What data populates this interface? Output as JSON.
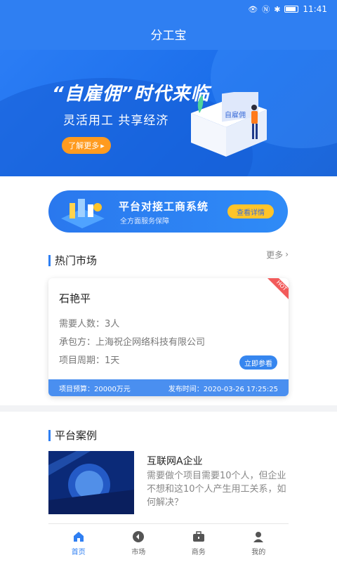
{
  "status_bar": {
    "time": "11:41"
  },
  "app": {
    "title": "分工宝"
  },
  "banner": {
    "title": "“自雇佣”时代来临",
    "subtitle": "灵活用工 共享经济",
    "button": "了解更多",
    "book_text": "自雇佣"
  },
  "promo": {
    "title": "平台对接工商系统",
    "subtitle": "全方面服务保障",
    "button": "查看详情"
  },
  "hot_market": {
    "title": "热门市场",
    "more": "更多",
    "card": {
      "badge": "HOT",
      "name": "石艳平",
      "people": "需要人数：3人",
      "contractor": "承包方：上海祝企网络科技有限公司",
      "period": "项目周期：1天",
      "button": "立即参看",
      "budget": "项目预算：20000万元",
      "publish_time": "发布时间：2020-03-26 17:25:25"
    }
  },
  "cases": {
    "title": "平台案例",
    "items": [
      {
        "title": "互联网A企业",
        "desc": "需要做个项目需要10个人，但企业不想和这10个人产生用工关系，如何解决？"
      }
    ]
  },
  "tabbar": {
    "items": [
      {
        "label": "首页",
        "icon": "home-icon",
        "active": true
      },
      {
        "label": "市场",
        "icon": "market-icon",
        "active": false
      },
      {
        "label": "商务",
        "icon": "briefcase-icon",
        "active": false
      },
      {
        "label": "我的",
        "icon": "user-icon",
        "active": false
      }
    ]
  },
  "colors": {
    "primary": "#2f7ff2",
    "accent_orange": "#ff9b1f",
    "accent_yellow": "#ffc429"
  }
}
